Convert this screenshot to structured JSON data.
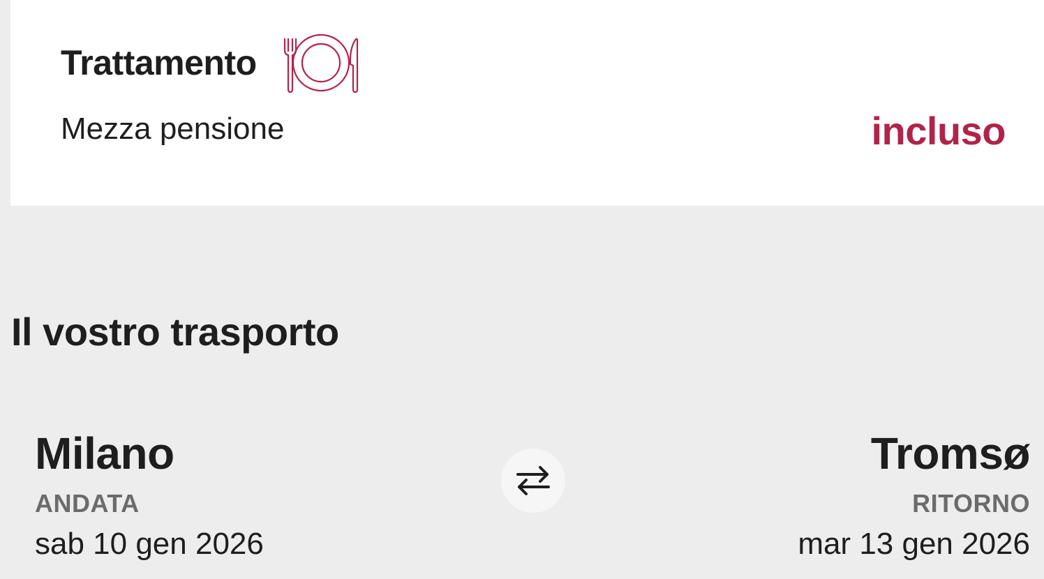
{
  "meal": {
    "title": "Trattamento",
    "icon": "plate-fork-knife-icon",
    "value": "Mezza pensione",
    "price": "incluso",
    "accent_color": "#b0244a"
  },
  "transport": {
    "section_title": "Il vostro trasporto",
    "outbound": {
      "city": "Milano",
      "direction": "ANDATA",
      "date": "sab 10 gen 2026"
    },
    "swap_icon": "swap-arrows-icon",
    "return": {
      "city": "Tromsø",
      "direction": "RITORNO",
      "date": "mar 13 gen 2026"
    }
  }
}
